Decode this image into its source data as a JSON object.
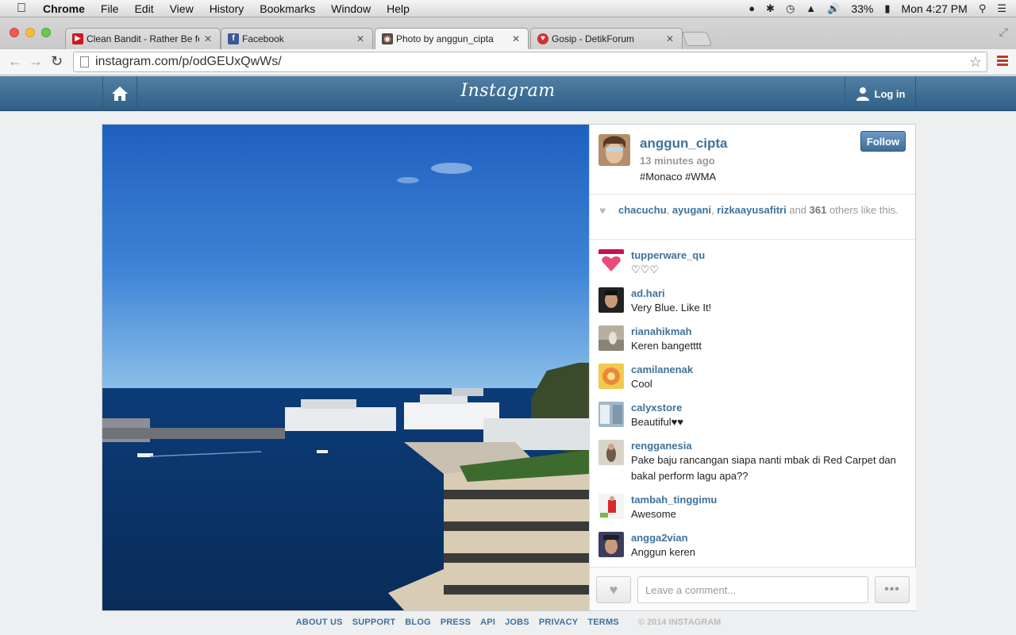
{
  "menubar": {
    "app": "Chrome",
    "menus": [
      "File",
      "Edit",
      "View",
      "History",
      "Bookmarks",
      "Window",
      "Help"
    ],
    "battery": "33%",
    "clock": "Mon 4:27 PM"
  },
  "tabs": [
    {
      "label": "Clean Bandit - Rather Be fe",
      "favicon": "youtube-icon",
      "color": "#cc181e"
    },
    {
      "label": "Facebook",
      "favicon": "facebook-icon",
      "color": "#3b5998"
    },
    {
      "label": "Photo by anggun_cipta",
      "favicon": "instagram-icon",
      "color": "#517fa4"
    },
    {
      "label": "Gosip - DetikForum",
      "favicon": "detik-icon",
      "color": "#d2322d"
    }
  ],
  "address": {
    "url": "instagram.com/p/odGEUxQwWs/"
  },
  "header": {
    "logo": "Instagram",
    "login_label": "Log in"
  },
  "post": {
    "owner": "anggun_cipta",
    "time": "13 minutes ago",
    "caption": "#Monaco #WMA",
    "follow_label": "Follow",
    "likers": [
      "chacuchu",
      "ayugani",
      "rizkaayusafitri"
    ],
    "likes_and": "and",
    "likes_count": "361",
    "likes_suffix": "others like this."
  },
  "comments": [
    {
      "user": "tupperware_qu",
      "text": "♡♡♡"
    },
    {
      "user": "ad.hari",
      "text": "Very Blue. Like It!"
    },
    {
      "user": "rianahikmah",
      "text": "Keren bangetttt"
    },
    {
      "user": "camilanenak",
      "text": "Cool"
    },
    {
      "user": "calyxstore",
      "text": "Beautiful♥♥"
    },
    {
      "user": "rengganesia",
      "text": "Pake baju rancangan siapa nanti mbak di Red Carpet dan bakal perform lagu apa??"
    },
    {
      "user": "tambah_tinggimu",
      "text": "Awesome"
    },
    {
      "user": "angga2vian",
      "text": "Anggun keren"
    }
  ],
  "composer": {
    "placeholder": "Leave a comment...",
    "more_label": "•••"
  },
  "footer": {
    "links": [
      "ABOUT US",
      "SUPPORT",
      "BLOG",
      "PRESS",
      "API",
      "JOBS",
      "PRIVACY",
      "TERMS"
    ],
    "copyright": "© 2014 INSTAGRAM"
  },
  "colors": {
    "brand": "#517fa4",
    "link": "#3f729b"
  }
}
